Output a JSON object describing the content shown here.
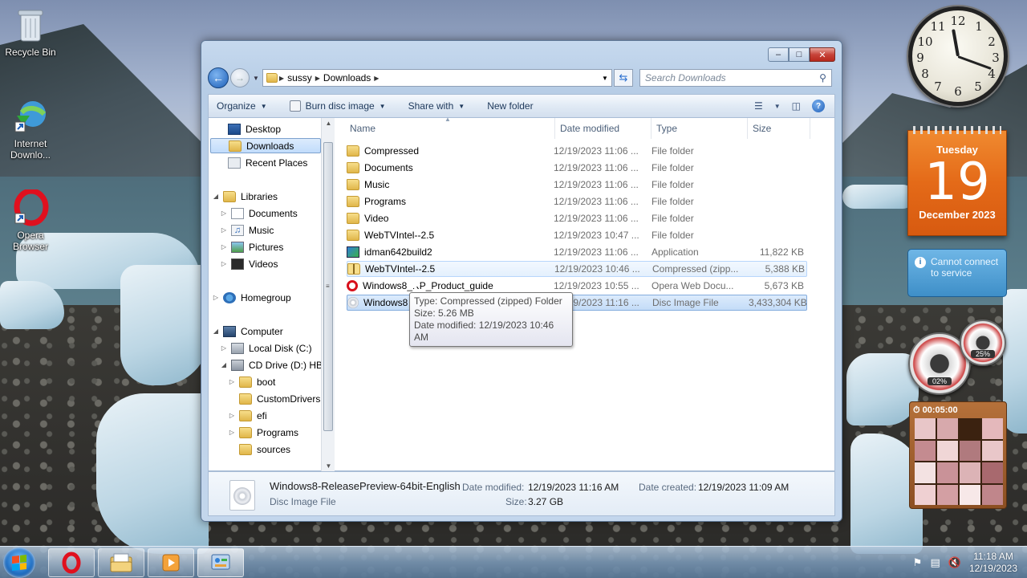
{
  "desktop": {
    "icons": [
      {
        "label": "Recycle Bin"
      },
      {
        "label": "Internet Downlo..."
      },
      {
        "label": "Opera Browser"
      }
    ]
  },
  "window": {
    "caption_buttons": {
      "minimize": "–",
      "maximize": "□",
      "close": "✕"
    },
    "address": {
      "segments": [
        "sussy",
        "Downloads"
      ],
      "search_placeholder": "Search Downloads"
    },
    "toolbar": {
      "organize": "Organize",
      "burn": "Burn disc image",
      "share": "Share with",
      "new_folder": "New folder",
      "help": "?"
    },
    "nav": {
      "desktop": "Desktop",
      "downloads": "Downloads",
      "recent": "Recent Places",
      "libraries": "Libraries",
      "documents": "Documents",
      "music": "Music",
      "pictures": "Pictures",
      "videos": "Videos",
      "homegroup": "Homegroup",
      "computer": "Computer",
      "local_disk": "Local Disk (C:)",
      "cd_drive": "CD Drive (D:) HB",
      "boot": "boot",
      "custom_drivers": "CustomDrivers",
      "efi": "efi",
      "programs": "Programs",
      "sources": "sources"
    },
    "columns": {
      "name": "Name",
      "date": "Date modified",
      "type": "Type",
      "size": "Size"
    },
    "files": [
      {
        "name": "Compressed",
        "date": "12/19/2023 11:06 ...",
        "type": "File folder",
        "size": ""
      },
      {
        "name": "Documents",
        "date": "12/19/2023 11:06 ...",
        "type": "File folder",
        "size": ""
      },
      {
        "name": "Music",
        "date": "12/19/2023 11:06 ...",
        "type": "File folder",
        "size": ""
      },
      {
        "name": "Programs",
        "date": "12/19/2023 11:06 ...",
        "type": "File folder",
        "size": ""
      },
      {
        "name": "Video",
        "date": "12/19/2023 11:06 ...",
        "type": "File folder",
        "size": ""
      },
      {
        "name": "WebTVIntel--2.5",
        "date": "12/19/2023 10:47 ...",
        "type": "File folder",
        "size": ""
      },
      {
        "name": "idman642build2",
        "date": "12/19/2023 11:06 ...",
        "type": "Application",
        "size": "11,822 KB"
      },
      {
        "name": "WebTVIntel--2.5",
        "date": "12/19/2023 10:46 ...",
        "type": "Compressed (zipp...",
        "size": "5,388 KB"
      },
      {
        "name": "Windows8_RP_Product_guide",
        "date": "12/19/2023 10:55 ...",
        "type": "Opera Web Docu...",
        "size": "5,673 KB"
      },
      {
        "name": "Windows8",
        "date": "12/19/2023 11:16 ...",
        "type": "Disc Image File",
        "size": "3,433,304 KB"
      }
    ],
    "tooltip": {
      "type": "Type: Compressed (zipped) Folder",
      "size": "Size: 5.26 MB",
      "date": "Date modified: 12/19/2023 10:46 AM"
    },
    "details": {
      "filename": "Windows8-ReleasePreview-64bit-English",
      "filetype": "Disc Image File",
      "date_modified_label": "Date modified:",
      "date_modified": "12/19/2023 11:16 AM",
      "date_created_label": "Date created:",
      "date_created": "12/19/2023 11:09 AM",
      "size_label": "Size:",
      "size": "3.27 GB"
    }
  },
  "gadgets": {
    "clock_numbers": [
      "12",
      "1",
      "2",
      "3",
      "4",
      "5",
      "6",
      "7",
      "8",
      "9",
      "10",
      "11"
    ],
    "calendar": {
      "weekday": "Tuesday",
      "day": "19",
      "month": "December 2023"
    },
    "weather": {
      "message": "Cannot connect to service",
      "info_icon": "i"
    },
    "cpu_meter": {
      "value": "02%"
    },
    "ram_meter": {
      "value": "25%"
    },
    "puzzle": {
      "timer": "00:05:00"
    }
  },
  "taskbar": {
    "time": "11:18 AM",
    "date": "12/19/2023"
  }
}
